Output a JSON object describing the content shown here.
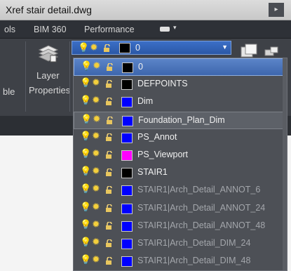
{
  "window": {
    "title": "Xref stair detail.dwg",
    "title_button": "▸"
  },
  "ribbon": {
    "tabs": [
      {
        "label": "ols"
      },
      {
        "label": "BIM 360"
      },
      {
        "label": "Performance"
      }
    ],
    "panel": {
      "left_cut_label": "ble",
      "layer_button_line1": "Layer",
      "layer_button_line2": "Properties"
    },
    "layer_combo": {
      "value": "0"
    }
  },
  "layers": [
    {
      "name": "0",
      "color": "#000000",
      "state": "selected"
    },
    {
      "name": "0",
      "color": "#000000",
      "state": "normal"
    },
    {
      "name": "DEFPOINTS",
      "color": "#000000",
      "state": "normal"
    },
    {
      "name": "Dim",
      "color": "#0000ff",
      "state": "normal"
    },
    {
      "name": "Foundation_Plan_Dim",
      "color": "#0000ff",
      "state": "hover"
    },
    {
      "name": "PS_Annot",
      "color": "#0000ff",
      "state": "normal"
    },
    {
      "name": "PS_Viewport",
      "color": "#ff00ff",
      "state": "normal"
    },
    {
      "name": "STAIR1",
      "color": "#000000",
      "state": "normal"
    },
    {
      "name": "STAIR1|Arch_Detail_ANNOT_6",
      "color": "#0000ff",
      "state": "dim"
    },
    {
      "name": "STAIR1|Arch_Detail_ANNOT_24",
      "color": "#0000ff",
      "state": "dim"
    },
    {
      "name": "STAIR1|Arch_Detail_ANNOT_48",
      "color": "#0000ff",
      "state": "dim"
    },
    {
      "name": "STAIR1|Arch_Detail_DIM_24",
      "color": "#0000ff",
      "state": "dim"
    },
    {
      "name": "STAIR1|Arch_Detail_DIM_48",
      "color": "#0000ff",
      "state": "dim"
    }
  ]
}
